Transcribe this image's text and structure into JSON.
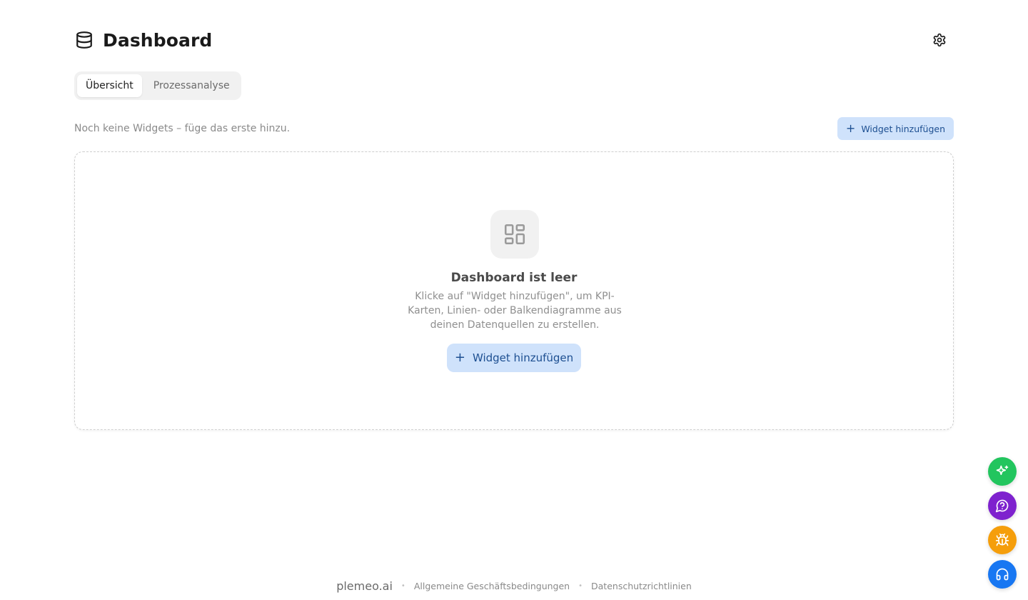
{
  "header": {
    "title": "Dashboard",
    "title_icon": "database-icon",
    "settings_icon": "gear-icon"
  },
  "tabs": [
    {
      "label": "Übersicht",
      "active": true
    },
    {
      "label": "Prozessanalyse",
      "active": false
    }
  ],
  "toolbar": {
    "hint": "Noch keine Widgets – füge das erste hinzu.",
    "add_label": "Widget hinzufügen"
  },
  "empty_state": {
    "icon": "layout-grid-icon",
    "title": "Dashboard ist leer",
    "description": "Klicke auf \"Widget hinzufügen\", um KPI-Karten, Linien- oder Balkendiagramme aus deinen Datenquellen zu erstellen.",
    "add_label": "Widget hinzufügen"
  },
  "floating_actions": [
    {
      "name": "sparkles-icon",
      "color": "#22c55e"
    },
    {
      "name": "help-chat-icon",
      "color": "#7e22ce"
    },
    {
      "name": "bug-icon",
      "color": "#f59e0b"
    },
    {
      "name": "headset-icon",
      "color": "#1877f2"
    }
  ],
  "footer": {
    "brand": "plemeo.ai",
    "links": [
      "Allgemeine Geschäftsbedingungen",
      "Datenschutzrichtlinien"
    ]
  },
  "colors": {
    "accent_bg": "#cfe2fb",
    "accent_text": "#1d4f91"
  }
}
